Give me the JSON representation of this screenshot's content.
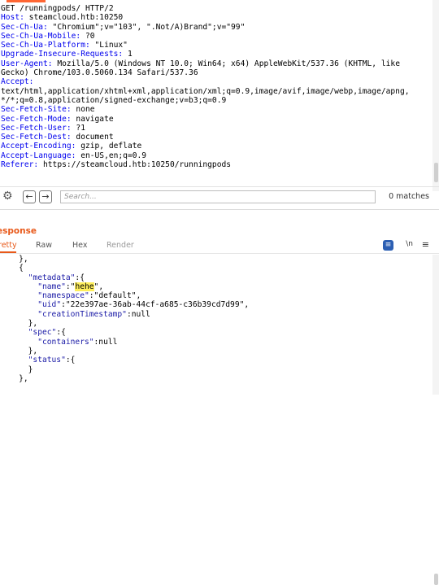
{
  "request": {
    "request_line": "GET /runningpods/ HTTP/2",
    "headers": [
      {
        "name": "Host",
        "value": "steamcloud.htb:10250"
      },
      {
        "name": "Sec-Ch-Ua",
        "value": "\"Chromium\";v=\"103\", \".Not/A)Brand\";v=\"99\""
      },
      {
        "name": "Sec-Ch-Ua-Mobile",
        "value": "?0"
      },
      {
        "name": "Sec-Ch-Ua-Platform",
        "value": "\"Linux\""
      },
      {
        "name": "Upgrade-Insecure-Requests",
        "value": "1"
      },
      {
        "name": "User-Agent",
        "value": "Mozilla/5.0 (Windows NT 10.0; Win64; x64) AppleWebKit/537.36 (KHTML, like"
      },
      {
        "name": "",
        "value": "Gecko) Chrome/103.0.5060.134 Safari/537.36"
      },
      {
        "name": "Accept",
        "value": ""
      },
      {
        "name": "",
        "value": "text/html,application/xhtml+xml,application/xml;q=0.9,image/avif,image/webp,image/apng,"
      },
      {
        "name": "",
        "value": "*/*;q=0.8,application/signed-exchange;v=b3;q=0.9"
      },
      {
        "name": "Sec-Fetch-Site",
        "value": "none"
      },
      {
        "name": "Sec-Fetch-Mode",
        "value": "navigate"
      },
      {
        "name": "Sec-Fetch-User",
        "value": "?1"
      },
      {
        "name": "Sec-Fetch-Dest",
        "value": "document"
      },
      {
        "name": "Accept-Encoding",
        "value": "gzip, deflate"
      },
      {
        "name": "Accept-Language",
        "value": "en-US,en;q=0.9"
      },
      {
        "name": "Referer",
        "value": "https://steamcloud.htb:10250/runningpods"
      }
    ]
  },
  "search": {
    "placeholder": "Search...",
    "matches": "0 matches",
    "prev_glyph": "←",
    "next_glyph": "→",
    "gear_glyph": "⚙"
  },
  "response": {
    "title": "esponse",
    "tabs": {
      "pretty": "retty",
      "raw": "Raw",
      "hex": "Hex",
      "render": "Render"
    },
    "toolbar": {
      "format_glyph": "≡",
      "newline": "\\n",
      "menu": "≡"
    },
    "lines": [
      "    },",
      "    {",
      "      \"metadata\":{",
      "        \"name\":\"hehe\",",
      "        \"namespace\":\"default\",",
      "        \"uid\":\"22e397ae-36ab-44cf-a685-c36b39cd7d99\",",
      "        \"creationTimestamp\":null",
      "      },",
      "      \"spec\":{",
      "        \"containers\":null",
      "      },",
      "      \"status\":{",
      "      }",
      "    },"
    ]
  },
  "colors": {
    "accent": "#e8591a",
    "header_name": "#0000ee",
    "highlight": "#ffef5c",
    "format_button": "#2c5fb3"
  }
}
